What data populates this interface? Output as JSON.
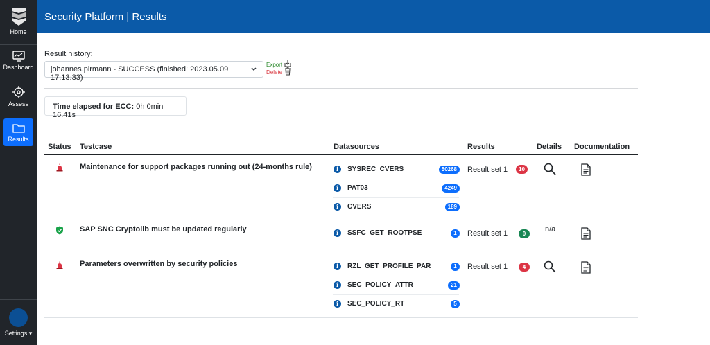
{
  "sidebar": {
    "home_label": "Home",
    "dashboard_label": "Dashboard",
    "assess_label": "Assess",
    "results_label": "Results",
    "settings_label": "Settings ▾",
    "icons": [
      "logo-icon",
      "monitor-icon",
      "target-icon",
      "folder-icon"
    ]
  },
  "header": {
    "title": "Security Platform | Results"
  },
  "history": {
    "label": "Result history:",
    "selected": "johannes.pirmann - SUCCESS (finished: 2023.05.09 17:13:33)",
    "export_label": "Export",
    "delete_label": "Delete"
  },
  "elapsed": {
    "label": "Time elapsed for ECC:",
    "value": "0h 0min 16.41s"
  },
  "table": {
    "headers": {
      "status": "Status",
      "testcase": "Testcase",
      "datasources": "Datasources",
      "results": "Results",
      "details": "Details",
      "documentation": "Documentation"
    },
    "rows": [
      {
        "status": "alarm",
        "testcase": "Maintenance for support packages running out (24-months rule)",
        "datasources": [
          {
            "name": "SYSREC_CVERS",
            "count": "50268"
          },
          {
            "name": "PAT03",
            "count": "4249"
          },
          {
            "name": "CVERS",
            "count": "189"
          }
        ],
        "result_set": "Result set 1",
        "result_count": "10",
        "details": "search"
      },
      {
        "status": "ok",
        "testcase": "SAP SNC Cryptolib must be updated regularly",
        "datasources": [
          {
            "name": "SSFC_GET_ROOTPSE",
            "count": "1"
          }
        ],
        "result_set": "Result set 1",
        "result_count": "0",
        "details": "n/a"
      },
      {
        "status": "alarm",
        "testcase": "Parameters overwritten by security policies",
        "datasources": [
          {
            "name": "RZL_GET_PROFILE_PAR",
            "count": "1"
          },
          {
            "name": "SEC_POLICY_ATTR",
            "count": "21"
          },
          {
            "name": "SEC_POLICY_RT",
            "count": "5"
          }
        ],
        "result_set": "Result set 1",
        "result_count": "4",
        "details": "search"
      }
    ]
  },
  "colors": {
    "header": "#0b5aa8",
    "sidebar": "#21252a",
    "accent": "#0d6efd",
    "danger": "#dc3545",
    "success": "#198754"
  }
}
